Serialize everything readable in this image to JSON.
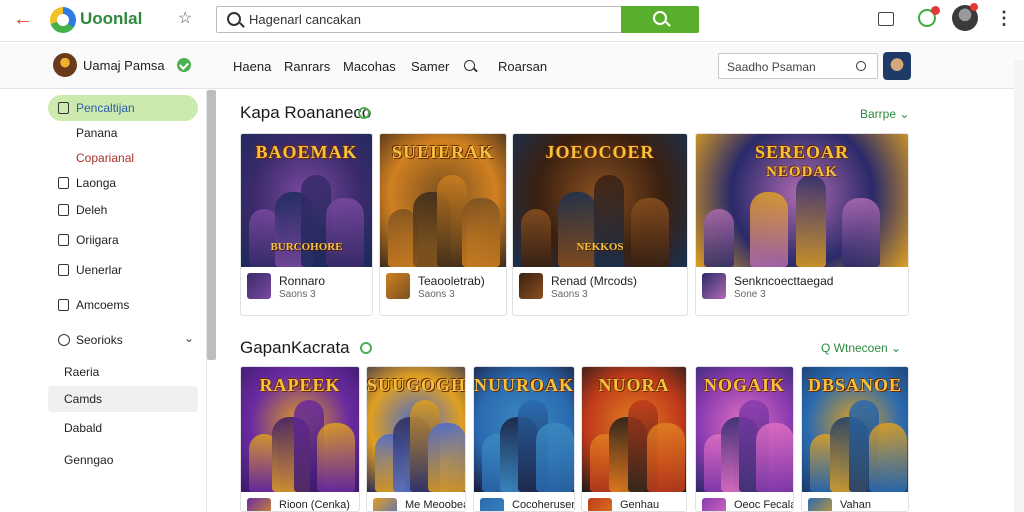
{
  "topbar": {
    "app_title": "Uoonlal",
    "search_value": "Hagenarl cancakan"
  },
  "subbar": {
    "user_name": "Uamaj Pamsa",
    "nav": [
      "Haena",
      "Ranrars",
      "Macohas",
      "Samer",
      "Roarsan"
    ],
    "search_value": "Saadho Psaman"
  },
  "sidebar": {
    "items": [
      {
        "label": "Pencaltijan",
        "state": "active"
      },
      {
        "label": "Panana"
      },
      {
        "label": "Coparianal"
      },
      {
        "label": "Laonga"
      },
      {
        "label": "Deleh"
      },
      {
        "label": "Oriigara"
      },
      {
        "label": "Uenerlar"
      },
      {
        "label": "Amcoems"
      },
      {
        "label": "Seorioks"
      },
      {
        "label": "Raeria"
      },
      {
        "label": "Camds",
        "state": "hover"
      },
      {
        "label": "Dabald"
      },
      {
        "label": "Genngao"
      }
    ]
  },
  "section1": {
    "title": "Kapa Roananeco",
    "action": "Barrpe",
    "cards": [
      {
        "art_title": "BAOEMAK",
        "art_sub": "BURCOHORE",
        "name": "Ronnaro",
        "meta": "Saons 3",
        "colors": [
          "#3a2a6a",
          "#7a4aa0",
          "#1a2a5a"
        ]
      },
      {
        "art_title": "SUEIERAK",
        "art_sub": "",
        "name": "Teaooletrab)",
        "meta": "Saons 3",
        "colors": [
          "#d08020",
          "#7a5020",
          "#3a2a1a"
        ]
      },
      {
        "art_title": "JOEOCOER",
        "art_sub": "NEKKOS",
        "name": "Renad (Mrcods)",
        "meta": "Saons 3",
        "colors": [
          "#3a2010",
          "#8a5020",
          "#1a3050"
        ]
      },
      {
        "art_title": "SEREOAR",
        "art_sub": "",
        "art_title2": "NEODAK",
        "name": "Senkncoecttaegad",
        "meta": "Sone 3",
        "colors": [
          "#2a2a6a",
          "#b06ab0",
          "#e0a020"
        ]
      }
    ]
  },
  "section2": {
    "title": "GapanKacrata",
    "action": "Q Wtnecoen",
    "cards": [
      {
        "art_title": "RAPEEK",
        "name": "Rioon (Cenka)",
        "colors": [
          "#6a2aa0",
          "#e0a020",
          "#3a1a6a"
        ]
      },
      {
        "art_title": "SUUGOGH",
        "name": "Me Meoobean",
        "colors": [
          "#e0a020",
          "#4a6ad0",
          "#2a2a5a"
        ]
      },
      {
        "art_title": "NUUROAK",
        "name": "Cocoherusen",
        "colors": [
          "#2a6ab0",
          "#3a8ac0",
          "#1a1a3a"
        ]
      },
      {
        "art_title": "NUORA",
        "name": "Genhau",
        "colors": [
          "#c03a1a",
          "#e08020",
          "#1a1a1a"
        ]
      },
      {
        "art_title": "NOGAIK",
        "name": "Oeoc Fecalaafrak:",
        "colors": [
          "#8a3ab0",
          "#e070c0",
          "#2a2a6a"
        ]
      },
      {
        "art_title": "DBSANOE",
        "name": "Vahan",
        "colors": [
          "#2a6ab0",
          "#e0a020",
          "#1a3a6a"
        ]
      }
    ]
  }
}
